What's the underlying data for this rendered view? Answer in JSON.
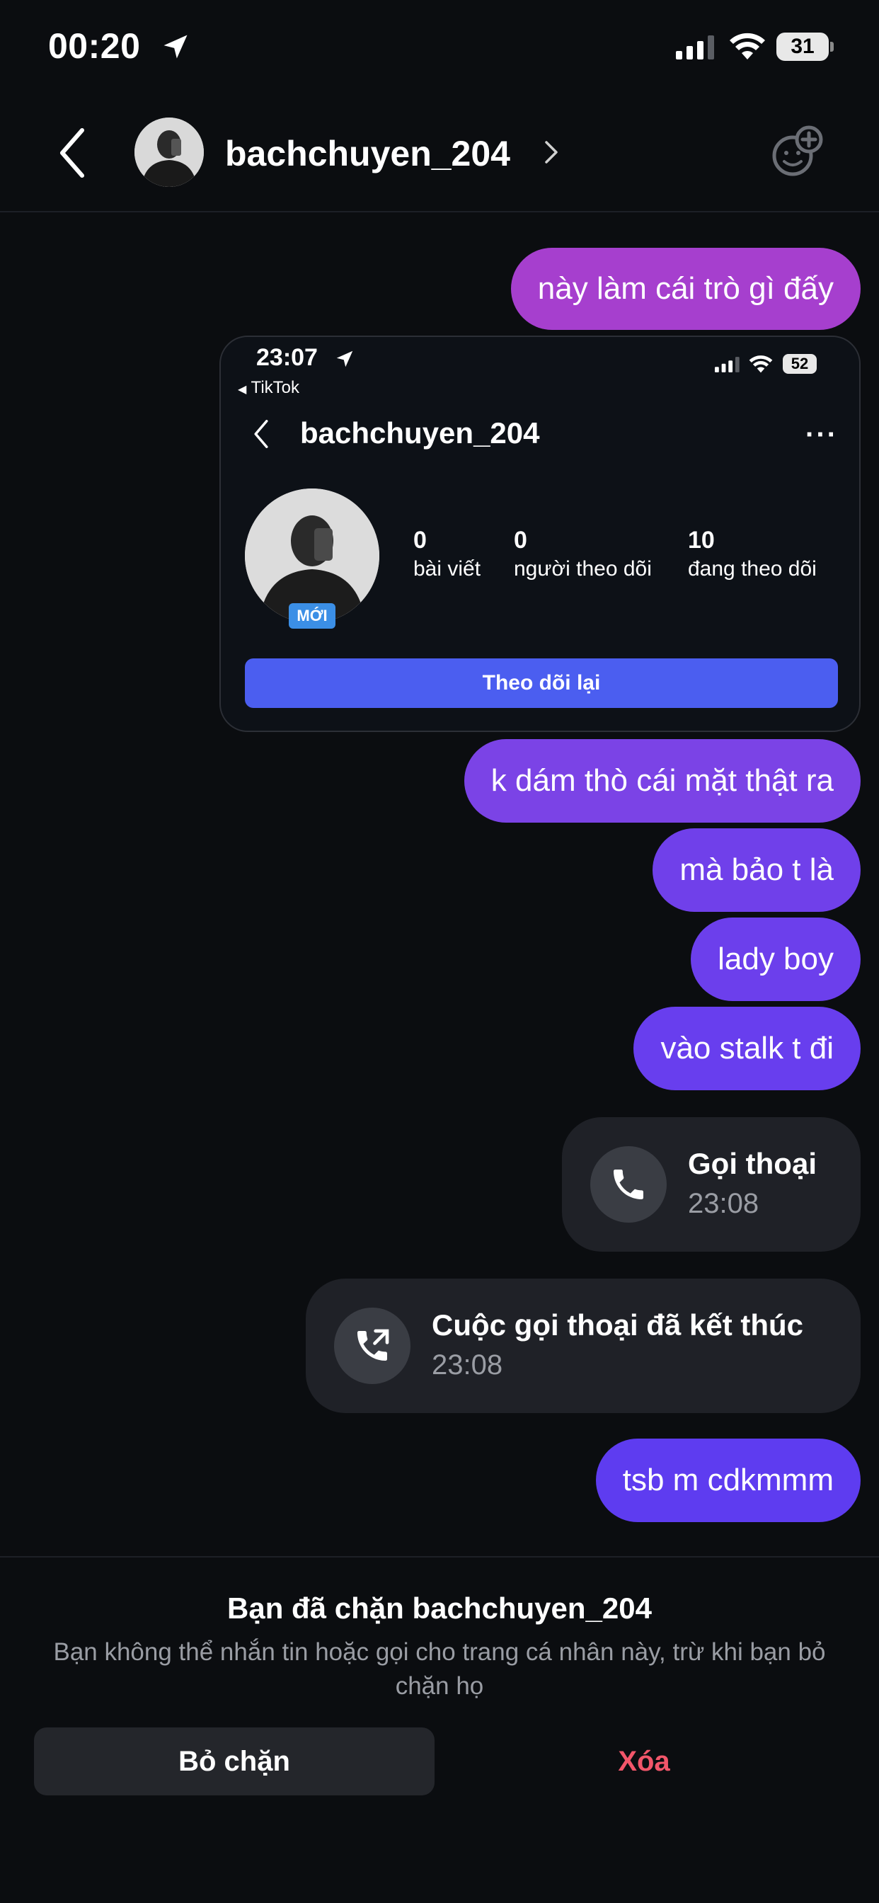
{
  "status_bar": {
    "time": "00:20",
    "battery": "31"
  },
  "header": {
    "username": "bachchuyen_204"
  },
  "messages": [
    {
      "text": "này làm cái trò gì đấy",
      "color": "#a63fce"
    },
    {
      "text": "k dám thò cái mặt thật ra",
      "color": "#7b43e6"
    },
    {
      "text": "mà bảo t là",
      "color": "#7040ea"
    },
    {
      "text": "lady boy",
      "color": "#6c3fec"
    },
    {
      "text": "vào stalk t đi",
      "color": "#683eee"
    },
    {
      "text": "tsb m cdkmmm",
      "color": "#5e3cf0"
    }
  ],
  "shared_screenshot": {
    "time": "23:07",
    "back_app": "TikTok",
    "battery": "52",
    "username": "bachchuyen_204",
    "badge": "MỚI",
    "stats": [
      {
        "value": "0",
        "label": "bài viết"
      },
      {
        "value": "0",
        "label": "người theo dõi"
      },
      {
        "value": "10",
        "label": "đang theo dõi"
      }
    ],
    "follow_back_label": "Theo dõi lại",
    "follow_back_color": "#4b5ef0"
  },
  "calls": [
    {
      "title": "Gọi thoại",
      "time": "23:08",
      "icon": "phone-icon"
    },
    {
      "title": "Cuộc gọi thoại đã kết thúc",
      "time": "23:08",
      "icon": "phone-outgoing-icon"
    }
  ],
  "blocked": {
    "title": "Bạn đã chặn bachchuyen_204",
    "description": "Bạn không thể nhắn tin hoặc gọi cho trang cá nhân này, trừ khi bạn bỏ chặn họ",
    "unblock_label": "Bỏ chặn",
    "delete_label": "Xóa",
    "delete_color": "#f2566a"
  }
}
